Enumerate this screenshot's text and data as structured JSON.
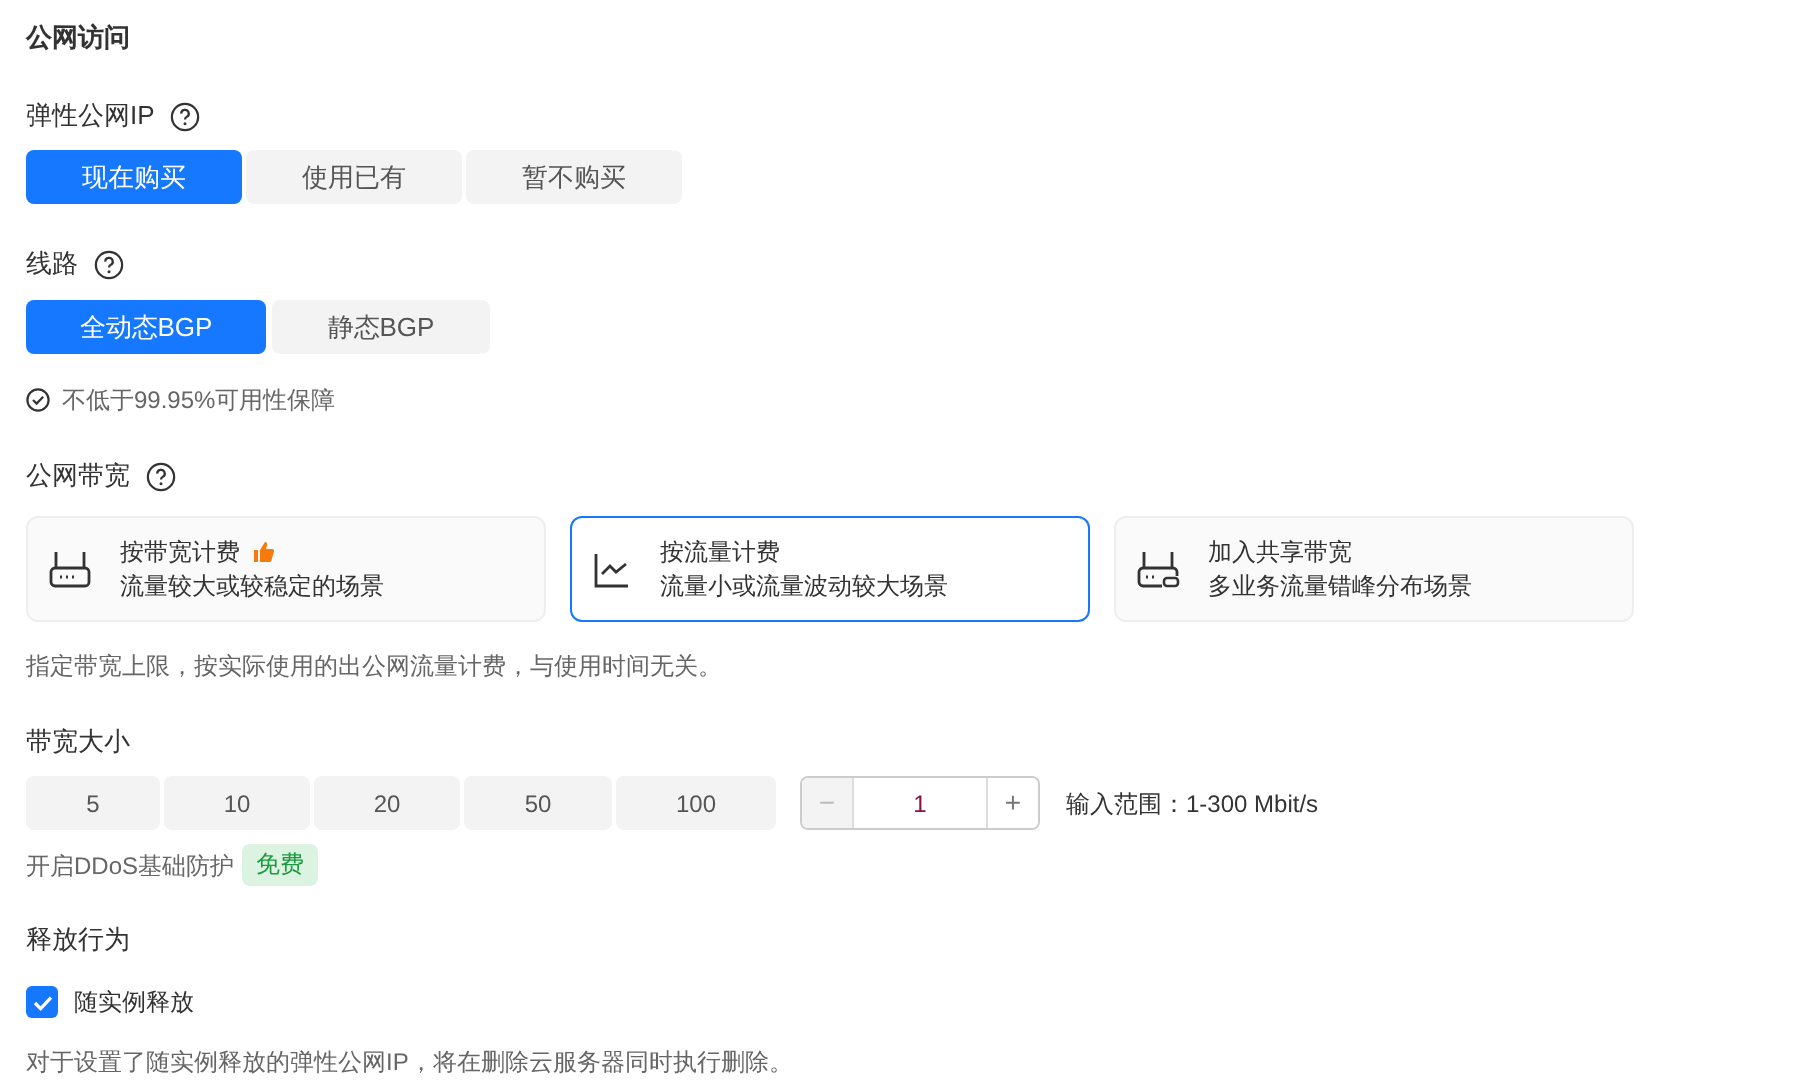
{
  "title": "公网访问",
  "eip": {
    "label": "弹性公网IP",
    "options": [
      {
        "label": "现在购买",
        "selected": true
      },
      {
        "label": "使用已有",
        "selected": false
      },
      {
        "label": "暂不购买",
        "selected": false
      }
    ]
  },
  "route": {
    "label": "线路",
    "options": [
      {
        "label": "全动态BGP",
        "selected": true
      },
      {
        "label": "静态BGP",
        "selected": false
      }
    ],
    "guarantee": "不低于99.95%可用性保障"
  },
  "bandwidth": {
    "label": "公网带宽",
    "cards": [
      {
        "kind": "router",
        "title": "按带宽计费",
        "recommended": true,
        "desc": "流量较大或较稳定的场景",
        "selected": false
      },
      {
        "kind": "chart",
        "title": "按流量计费",
        "recommended": false,
        "desc": "流量小或流量波动较大场景",
        "selected": true
      },
      {
        "kind": "shared",
        "title": "加入共享带宽",
        "recommended": false,
        "desc": "多业务流量错峰分布场景",
        "selected": false
      }
    ],
    "hint": "指定带宽上限，按实际使用的出公网流量计费，与使用时间无关。"
  },
  "size": {
    "label": "带宽大小",
    "presets": [
      {
        "label": "5",
        "selected": false
      },
      {
        "label": "10",
        "selected": false
      },
      {
        "label": "20",
        "selected": false
      },
      {
        "label": "50",
        "selected": false
      },
      {
        "label": "100",
        "selected": false
      }
    ],
    "stepper": {
      "minus": "−",
      "value": "1",
      "plus": "+",
      "minus_disabled": true
    },
    "range": "输入范围：1-300 Mbit/s",
    "ddos": "开启DDoS基础防护",
    "ddos_badge": "免费"
  },
  "release": {
    "label": "释放行为",
    "checkbox": {
      "label": "随实例释放",
      "checked": true
    },
    "note": "对于设置了随实例释放的弹性公网IP，将在删除云服务器同时执行删除。"
  }
}
